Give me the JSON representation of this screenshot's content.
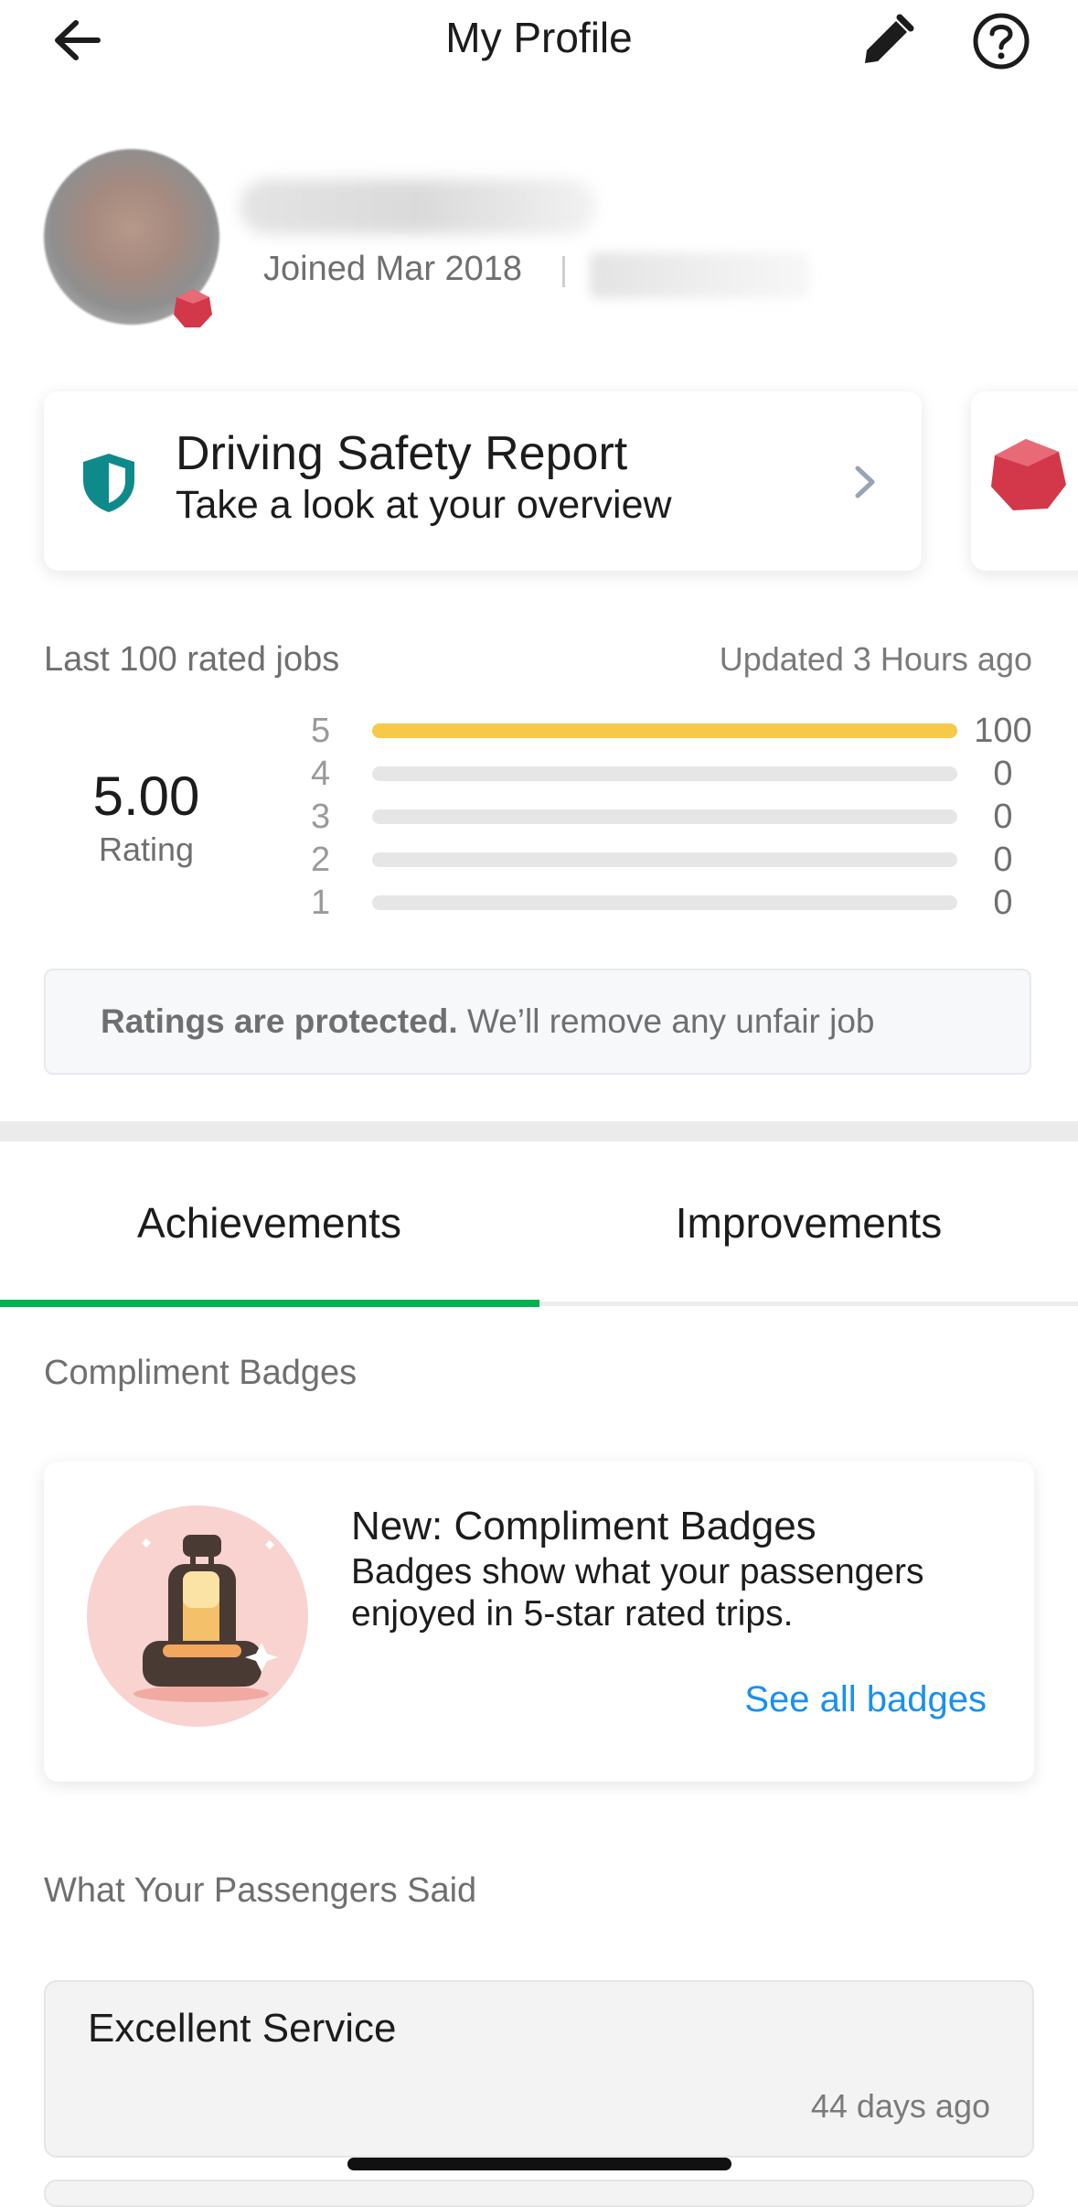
{
  "header": {
    "title": "My Profile",
    "back_icon": "arrow-left-icon",
    "edit_icon": "pencil-icon",
    "help_icon": "question-circle-icon"
  },
  "profile": {
    "joined": "Joined Mar 2018",
    "tier_icon": "ruby-gem-icon"
  },
  "safety_card": {
    "title": "Driving Safety Report",
    "subtitle": "Take a look at your overview",
    "icon": "shield-icon",
    "chevron": "chevron-right-icon"
  },
  "ratings": {
    "label": "Last 100 rated jobs",
    "updated": "Updated 3 Hours ago",
    "average": "5.00",
    "average_label": "Rating",
    "rows": [
      {
        "star": "5",
        "count": "100",
        "fraction": 1.0
      },
      {
        "star": "4",
        "count": "0",
        "fraction": 0
      },
      {
        "star": "3",
        "count": "0",
        "fraction": 0
      },
      {
        "star": "2",
        "count": "0",
        "fraction": 0
      },
      {
        "star": "1",
        "count": "0",
        "fraction": 0
      }
    ],
    "protect_bold": "Ratings are protected.",
    "protect_rest": "We’ll remove any unfair job",
    "bar_color": "#f7c948"
  },
  "tabs": [
    {
      "label": "Achievements",
      "active": true
    },
    {
      "label": "Improvements",
      "active": false
    }
  ],
  "accent_color": "#00b14f",
  "compliment": {
    "section_label": "Compliment Badges",
    "title": "New: Compliment Badges",
    "description": "Badges show what your passengers enjoyed in 5-star rated trips.",
    "link": "See all badges",
    "illustration_icon": "car-seat-icon"
  },
  "passengers": {
    "section_label": "What Your Passengers Said",
    "reviews": [
      {
        "text": "Excellent Service",
        "date": "44 days ago"
      }
    ]
  }
}
